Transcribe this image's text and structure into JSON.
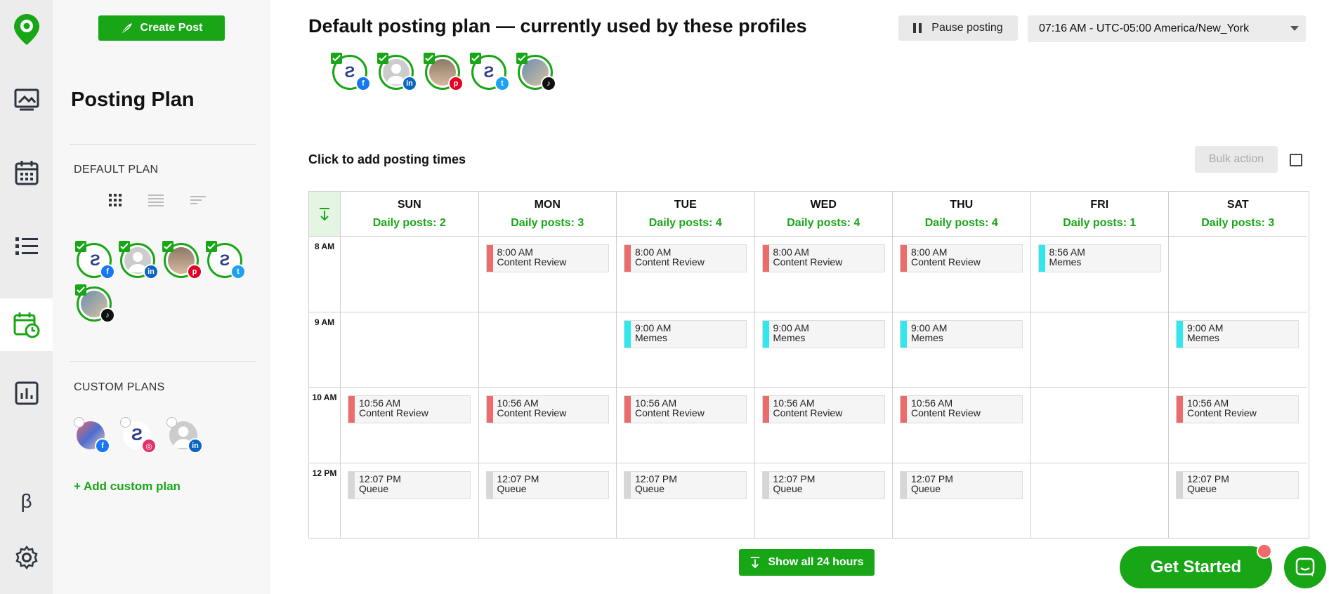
{
  "sidebar": {
    "create_post_label": "Create Post",
    "title": "Posting Plan",
    "default_plan_label": "DEFAULT PLAN",
    "custom_plans_label": "CUSTOM PLANS",
    "add_custom_plan_label": "+ Add custom plan"
  },
  "rail": {
    "beta_label": "β"
  },
  "header": {
    "title": "Default posting plan — currently used by these profiles",
    "pause_label": "Pause posting",
    "timezone": "07:16 AM - UTC-05:00 America/New_York"
  },
  "schedule": {
    "click_to_add": "Click to add posting times",
    "bulk_action_label": "Bulk action",
    "days": [
      {
        "name": "SUN",
        "daily": "Daily posts: 2"
      },
      {
        "name": "MON",
        "daily": "Daily posts: 3"
      },
      {
        "name": "TUE",
        "daily": "Daily posts: 4"
      },
      {
        "name": "WED",
        "daily": "Daily posts: 4"
      },
      {
        "name": "THU",
        "daily": "Daily posts: 4"
      },
      {
        "name": "FRI",
        "daily": "Daily posts: 1"
      },
      {
        "name": "SAT",
        "daily": "Daily posts: 3"
      }
    ],
    "hours": [
      "8 AM",
      "9 AM",
      "10 AM",
      "12 PM"
    ],
    "colors": {
      "content_review": "#ec6b6b",
      "memes": "#2ee8ee",
      "queue": "#d6d6d6"
    },
    "slots": [
      {
        "day": 1,
        "hour": 0,
        "time": "8:00 AM",
        "name": "Content Review",
        "kind": "content_review"
      },
      {
        "day": 2,
        "hour": 0,
        "time": "8:00 AM",
        "name": "Content Review",
        "kind": "content_review"
      },
      {
        "day": 3,
        "hour": 0,
        "time": "8:00 AM",
        "name": "Content Review",
        "kind": "content_review"
      },
      {
        "day": 4,
        "hour": 0,
        "time": "8:00 AM",
        "name": "Content Review",
        "kind": "content_review"
      },
      {
        "day": 5,
        "hour": 0,
        "time": "8:56 AM",
        "name": "Memes",
        "kind": "memes"
      },
      {
        "day": 2,
        "hour": 1,
        "time": "9:00 AM",
        "name": "Memes",
        "kind": "memes"
      },
      {
        "day": 3,
        "hour": 1,
        "time": "9:00 AM",
        "name": "Memes",
        "kind": "memes"
      },
      {
        "day": 4,
        "hour": 1,
        "time": "9:00 AM",
        "name": "Memes",
        "kind": "memes"
      },
      {
        "day": 6,
        "hour": 1,
        "time": "9:00 AM",
        "name": "Memes",
        "kind": "memes"
      },
      {
        "day": 0,
        "hour": 2,
        "time": "10:56 AM",
        "name": "Content Review",
        "kind": "content_review"
      },
      {
        "day": 1,
        "hour": 2,
        "time": "10:56 AM",
        "name": "Content Review",
        "kind": "content_review"
      },
      {
        "day": 2,
        "hour": 2,
        "time": "10:56 AM",
        "name": "Content Review",
        "kind": "content_review"
      },
      {
        "day": 3,
        "hour": 2,
        "time": "10:56 AM",
        "name": "Content Review",
        "kind": "content_review"
      },
      {
        "day": 4,
        "hour": 2,
        "time": "10:56 AM",
        "name": "Content Review",
        "kind": "content_review"
      },
      {
        "day": 6,
        "hour": 2,
        "time": "10:56 AM",
        "name": "Content Review",
        "kind": "content_review"
      },
      {
        "day": 0,
        "hour": 3,
        "time": "12:07 PM",
        "name": "Queue",
        "kind": "queue"
      },
      {
        "day": 1,
        "hour": 3,
        "time": "12:07 PM",
        "name": "Queue",
        "kind": "queue"
      },
      {
        "day": 2,
        "hour": 3,
        "time": "12:07 PM",
        "name": "Queue",
        "kind": "queue"
      },
      {
        "day": 3,
        "hour": 3,
        "time": "12:07 PM",
        "name": "Queue",
        "kind": "queue"
      },
      {
        "day": 4,
        "hour": 3,
        "time": "12:07 PM",
        "name": "Queue",
        "kind": "queue"
      },
      {
        "day": 6,
        "hour": 3,
        "time": "12:07 PM",
        "name": "Queue",
        "kind": "queue"
      }
    ]
  },
  "footer": {
    "show_all_label": "Show all 24 hours",
    "get_started_label": "Get Started"
  },
  "profiles": [
    {
      "avatar": "brand-logo",
      "network": "facebook-icon",
      "color": "#1877f2"
    },
    {
      "avatar": "default-user",
      "network": "linkedin-icon",
      "color": "#0a66c2"
    },
    {
      "avatar": "person-photo",
      "network": "pinterest-icon",
      "color": "#e60023"
    },
    {
      "avatar": "brand-logo",
      "network": "twitter-icon",
      "color": "#1da1f2"
    },
    {
      "avatar": "person-photo",
      "network": "tiktok-icon",
      "color": "#111111"
    }
  ],
  "custom_profiles": [
    {
      "avatar": "colorful-photo",
      "network": "facebook-icon",
      "color": "#1877f2"
    },
    {
      "avatar": "brand-logo",
      "network": "instagram-icon",
      "color": "#e1306c"
    },
    {
      "avatar": "default-user",
      "network": "linkedin-icon",
      "color": "#0a66c2"
    }
  ],
  "accent_color": "#18a617"
}
